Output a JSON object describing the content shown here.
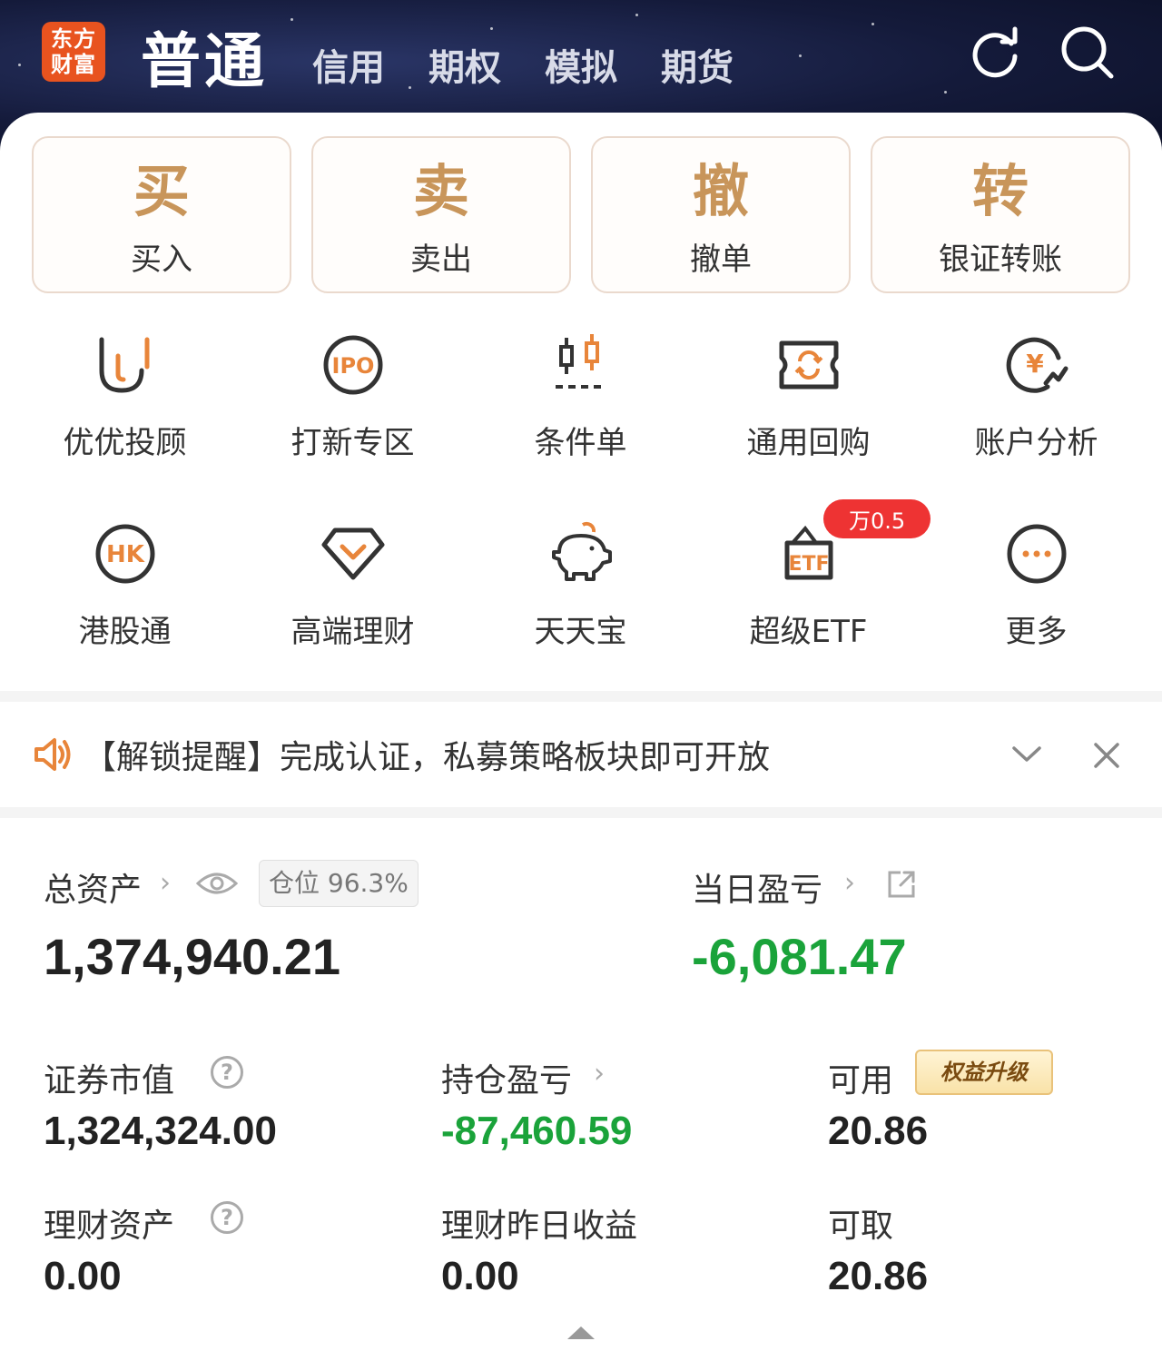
{
  "header": {
    "logo_line1": "东方",
    "logo_line2": "财富",
    "active_tab": "普通",
    "tabs": [
      "信用",
      "期权",
      "模拟",
      "期货"
    ]
  },
  "big_buttons": [
    {
      "glyph": "买",
      "label": "买入"
    },
    {
      "glyph": "卖",
      "label": "卖出"
    },
    {
      "glyph": "撤",
      "label": "撤单"
    },
    {
      "glyph": "转",
      "label": "银证转账"
    }
  ],
  "grid_row1": [
    {
      "icon": "youyou-icon",
      "label": "优优投顾"
    },
    {
      "icon": "ipo-icon",
      "label": "打新专区"
    },
    {
      "icon": "candlestick-icon",
      "label": "条件单"
    },
    {
      "icon": "repurchase-icon",
      "label": "通用回购"
    },
    {
      "icon": "account-analysis-icon",
      "label": "账户分析"
    }
  ],
  "grid_row2": [
    {
      "icon": "hk-icon",
      "label": "港股通"
    },
    {
      "icon": "diamond-icon",
      "label": "高端理财"
    },
    {
      "icon": "piggy-bank-icon",
      "label": "天天宝"
    },
    {
      "icon": "etf-icon",
      "label": "超级ETF",
      "badge": "万0.5"
    },
    {
      "icon": "more-icon",
      "label": "更多"
    }
  ],
  "notice": {
    "text": "【解锁提醒】完成认证，私募策略板块即可开放"
  },
  "assets": {
    "total_label": "总资产",
    "position_pill": "仓位 96.3%",
    "total_value": "1,374,940.21",
    "daily_pl_label": "当日盈亏",
    "daily_pl_value": "-6,081.47",
    "securities_label": "证券市值",
    "securities_value": "1,324,324.00",
    "holding_pl_label": "持仓盈亏",
    "holding_pl_value": "-87,460.59",
    "available_label": "可用",
    "upgrade_pill": "权益升级",
    "available_value": "20.86",
    "wealth_label": "理财资产",
    "wealth_value": "0.00",
    "wealth_yesterday_label": "理财昨日收益",
    "wealth_yesterday_value": "0.00",
    "withdrawable_label": "可取",
    "withdrawable_value": "20.86"
  },
  "colors": {
    "accent_gold": "#c8955a",
    "icon_orange": "#e8853a",
    "negative_green": "#1aa33a",
    "badge_red": "#ee3333",
    "header_bg": "#141a3a"
  }
}
